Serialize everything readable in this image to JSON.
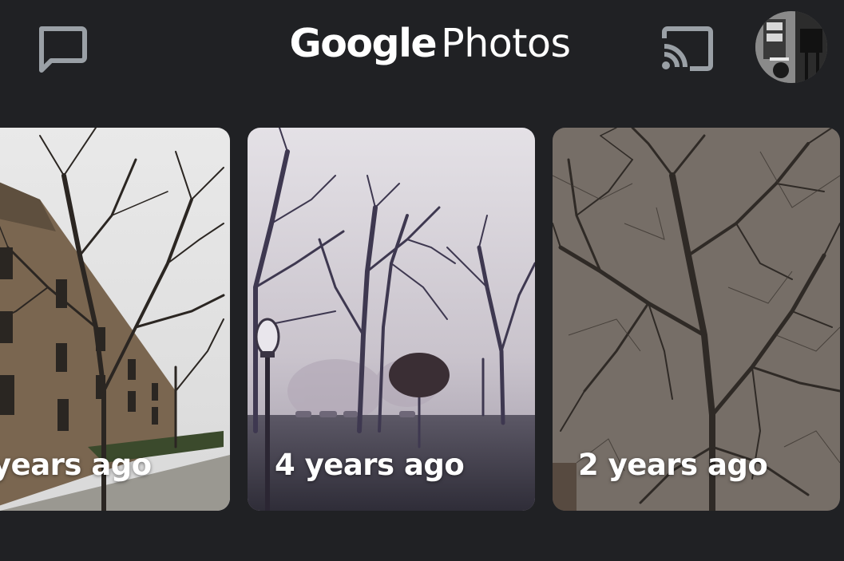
{
  "header": {
    "title_brand": "Google",
    "title_product": "Photos",
    "icons": {
      "messages": "chat-bubble-icon",
      "cast": "cast-icon",
      "account": "account-avatar"
    }
  },
  "memories": [
    {
      "label": "years ago"
    },
    {
      "label": "4 years ago"
    },
    {
      "label": "2 years ago"
    }
  ],
  "colors": {
    "background": "#202124",
    "text": "#ffffff",
    "icon": "#9aa0a6"
  }
}
